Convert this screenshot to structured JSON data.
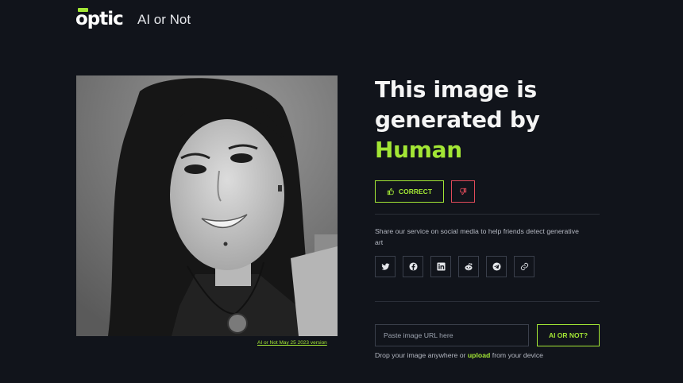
{
  "header": {
    "logo_text": "optic",
    "app_name": "AI or Not"
  },
  "result": {
    "title_line1": "This image is",
    "title_line2": "generated by",
    "verdict": "Human"
  },
  "image": {
    "version_link": "AI or Not May 25 2023 version"
  },
  "feedback": {
    "correct_label": "CORRECT"
  },
  "share": {
    "text": "Share our service on social media to help friends detect generative art",
    "icons": [
      "twitter-icon",
      "facebook-icon",
      "linkedin-icon",
      "reddit-icon",
      "telegram-icon",
      "link-icon"
    ]
  },
  "upload": {
    "placeholder": "Paste image URL here",
    "check_label": "AI OR NOT?",
    "drop_prefix": "Drop your image anywhere or",
    "upload_link": "upload",
    "drop_suffix": "from your device"
  },
  "colors": {
    "accent": "#a3e635",
    "background": "#11141b",
    "danger": "#e14b5a"
  }
}
